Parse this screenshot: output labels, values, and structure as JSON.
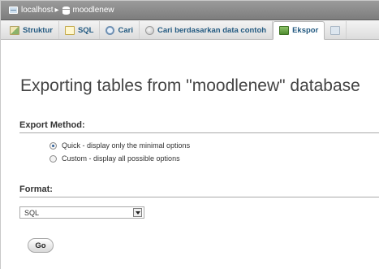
{
  "breadcrumb": {
    "server": "localhost",
    "separator": "▸",
    "database": "moodlenew"
  },
  "tabs": [
    {
      "label": "Struktur",
      "icon": "table-structure-icon"
    },
    {
      "label": "SQL",
      "icon": "sql-icon"
    },
    {
      "label": "Cari",
      "icon": "search-icon"
    },
    {
      "label": "Cari berdasarkan data contoh",
      "icon": "query-icon"
    },
    {
      "label": "Ekspor",
      "icon": "export-icon",
      "active": true
    }
  ],
  "page": {
    "title": "Exporting tables from \"moodlenew\" database"
  },
  "export_method": {
    "label": "Export Method:",
    "options": [
      {
        "label": "Quick - display only the minimal options",
        "checked": true
      },
      {
        "label": "Custom - display all possible options",
        "checked": false
      }
    ]
  },
  "format": {
    "label": "Format:",
    "selected": "SQL"
  },
  "go_button": "Go",
  "colors": {
    "tab_text": "#235a81",
    "breadcrumb_bg": "#8a8a8a",
    "title_text": "#444444"
  }
}
